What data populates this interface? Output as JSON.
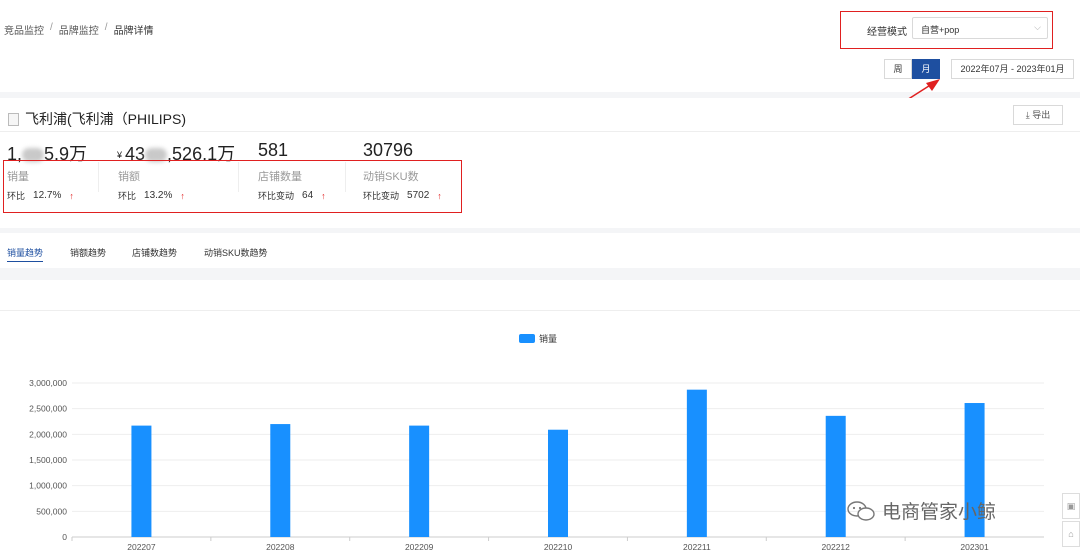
{
  "breadcrumb": {
    "items": [
      "竞品监控",
      "品牌监控",
      "品牌详情"
    ],
    "separator": "/"
  },
  "mode": {
    "label": "经营模式",
    "value": "自营+pop"
  },
  "period": {
    "week_label": "周",
    "month_label": "月",
    "active": "月",
    "date_range": "2022年07月 - 2023年01月"
  },
  "brand": {
    "title": "飞利浦(飞利浦（PHILIPS)",
    "export_label": "导出"
  },
  "kpis": [
    {
      "value_prefix": "1,",
      "value_suffix": "5.9万",
      "currency": "",
      "label": "销量",
      "change_label": "环比",
      "change_value": "12.7%",
      "trend": "↑"
    },
    {
      "value_prefix": "43",
      "value_suffix": ",526.1万",
      "currency": "¥",
      "label": "销额",
      "change_label": "环比",
      "change_value": "13.2%",
      "trend": "↑"
    },
    {
      "value_prefix": "581",
      "value_suffix": "",
      "currency": "",
      "label": "店铺数量",
      "change_label": "环比变动",
      "change_value": "64",
      "trend": "↑"
    },
    {
      "value_prefix": "30796",
      "value_suffix": "",
      "currency": "",
      "label": "动销SKU数",
      "change_label": "环比变动",
      "change_value": "5702",
      "trend": "↑"
    }
  ],
  "tabs": [
    "销量趋势",
    "销额趋势",
    "店铺数趋势",
    "动销SKU数趋势"
  ],
  "active_tab": "销量趋势",
  "chart_data": {
    "type": "bar",
    "categories": [
      "202207",
      "202208",
      "202209",
      "202210",
      "202211",
      "202212",
      "202301"
    ],
    "series": [
      {
        "name": "销量",
        "values": [
          2170000,
          2200000,
          2170000,
          2090000,
          2870000,
          2360000,
          2610000
        ],
        "color": "#1890ff"
      }
    ],
    "yticks": [
      "0",
      "500,000",
      "1,000,000",
      "1,500,000",
      "2,000,000",
      "2,500,000",
      "3,000,000"
    ],
    "ylim": [
      0,
      3000000
    ],
    "legend_position": "top-center",
    "grid": true
  },
  "watermark": "电商管家小鲸",
  "colors": {
    "accent": "#1e4fa0",
    "highlight": "#e02020",
    "bar": "#1890ff",
    "up": "#e02020"
  }
}
